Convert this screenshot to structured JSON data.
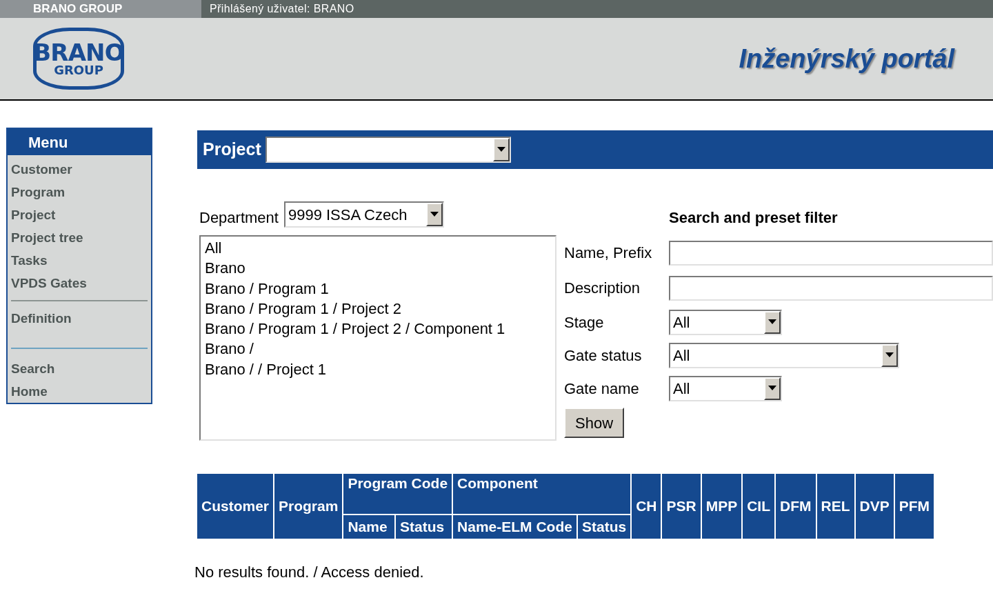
{
  "top_bar": {
    "brand": "BRANO GROUP",
    "user": "Přihlášený uživatel: BRANO"
  },
  "header": {
    "logo_top": "BRANO",
    "logo_bottom": "GROUP",
    "title": "Inženýrský portál"
  },
  "menu": {
    "title": "Menu",
    "sections": [
      {
        "items": [
          "Customer",
          "Program",
          "Project",
          "Project tree",
          "Tasks",
          "VPDS Gates"
        ]
      },
      {
        "items": [
          "Definition"
        ]
      },
      {
        "items": [
          "Search",
          "Home"
        ]
      }
    ]
  },
  "project": {
    "label": "Project"
  },
  "department": {
    "label": "Department",
    "value": "9999 ISSA Czech"
  },
  "project_list": [
    {
      "text": "All",
      "selected": false
    },
    {
      "text": "Brano",
      "selected": false
    },
    {
      "text": "Brano / Program 1",
      "selected": false
    },
    {
      "text": "Brano / Program 1 / Project 2",
      "selected": false
    },
    {
      "text": "Brano / Program 1 / Project 2 / Component 1",
      "selected": false
    },
    {
      "text": "Brano /",
      "selected": false
    },
    {
      "text": "Brano / / Project 1",
      "selected": false
    }
  ],
  "filter": {
    "title": "Search and preset filter",
    "fields": [
      {
        "kind": "text",
        "label": "Name, Prefix"
      },
      {
        "kind": "text",
        "label": "Description"
      },
      {
        "kind": "select",
        "label": "Stage",
        "value": "All"
      },
      {
        "kind": "select",
        "label": "Gate status",
        "value": "All"
      },
      {
        "kind": "select",
        "label": "Gate name",
        "value": "All"
      }
    ],
    "button": "Show"
  },
  "table": {
    "columns": [
      {
        "label": "Customer"
      },
      {
        "label": "Program"
      },
      {
        "label": "Program Code",
        "subcolumns": [
          "Name",
          "Status"
        ]
      },
      {
        "label": "Component",
        "subcolumns": [
          "Name-ELM Code",
          "Status"
        ]
      },
      {
        "label": "CH"
      },
      {
        "label": "PSR"
      },
      {
        "label": "MPP"
      },
      {
        "label": "CIL"
      },
      {
        "label": "DFM"
      },
      {
        "label": "REL"
      },
      {
        "label": "DVP"
      },
      {
        "label": "PFM"
      }
    ]
  },
  "message": "No results found. / Access denied."
}
